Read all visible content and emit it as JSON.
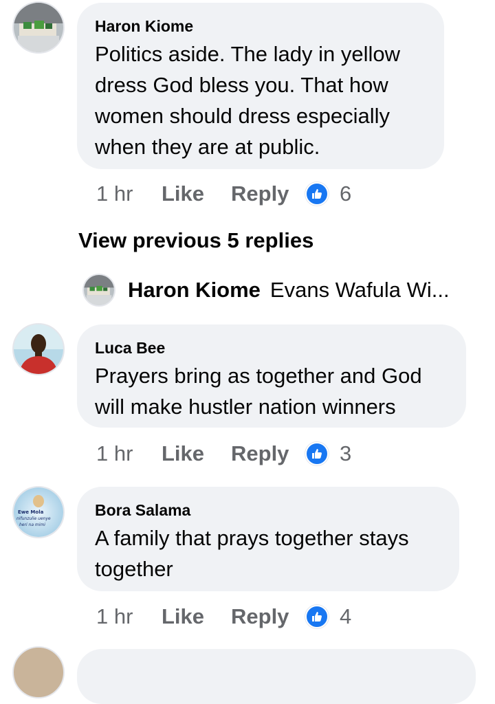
{
  "colors": {
    "bubble": "#f0f2f5",
    "meta_text": "#65676b",
    "like_blue": "#1877f2"
  },
  "comments": [
    {
      "author": "Haron Kiome",
      "text": "Politics aside. The lady in yellow dress God bless you. That how women should dress especially when they are at public.",
      "time": "1 hr",
      "like": "Like",
      "reply": "Reply",
      "likes": "6",
      "avatar_icon": "avatar-desk-photo"
    },
    {
      "author": "Luca Bee",
      "text": "Prayers bring as together and God will make hustler nation winners",
      "time": "1 hr",
      "like": "Like",
      "reply": "Reply",
      "likes": "3",
      "avatar_icon": "avatar-person-photo"
    },
    {
      "author": "Bora Salama",
      "text": "A family that prays together stays together",
      "time": "1 hr",
      "like": "Like",
      "reply": "Reply",
      "likes": "4",
      "avatar_icon": "avatar-text-image",
      "avatar_text": [
        "Ewe Mola",
        "nifunzulie uenye",
        "heri na mimi"
      ]
    }
  ],
  "view_previous": "View previous 5 replies",
  "reply_preview": {
    "name": "Haron Kiome",
    "snippet": "Evans Wafula Wi..."
  }
}
